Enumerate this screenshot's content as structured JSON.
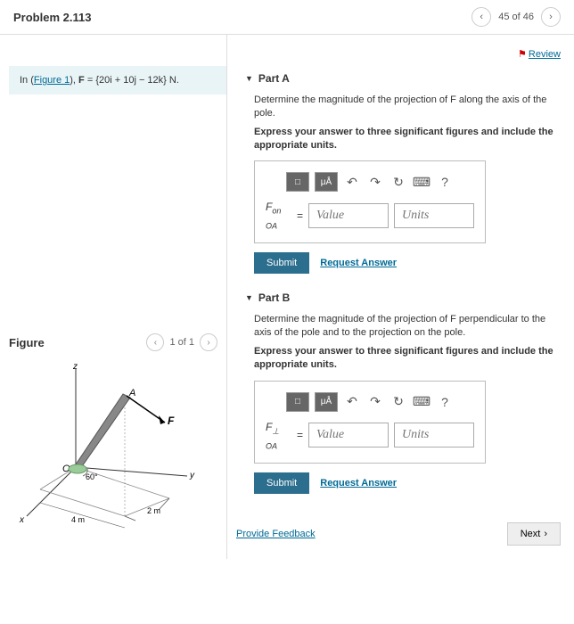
{
  "header": {
    "title": "Problem 2.113",
    "position": "45 of 46"
  },
  "review_label": "Review",
  "intro": {
    "prefix": "In (",
    "figure_link": "Figure 1",
    "suffix": "), ",
    "equation_lhs": "F",
    "equation_eq": " = ",
    "equation_rhs": "{20i + 10j − 12k}",
    "equation_unit": " N."
  },
  "partA": {
    "title": "Part A",
    "description": "Determine the magnitude of the projection of F along the axis of the pole.",
    "instruction": "Express your answer to three significant figures and include the appropriate units.",
    "label_html": "F",
    "label_sub": "on OA",
    "eq": "=",
    "value_ph": "Value",
    "units_ph": "Units",
    "submit": "Submit",
    "request": "Request Answer",
    "toolbar": {
      "t1": "□",
      "t2": "μÅ",
      "help": "?"
    }
  },
  "partB": {
    "title": "Part B",
    "description": "Determine the magnitude of the projection of F perpendicular to the axis of the pole and to the projection on the pole.",
    "instruction": "Express your answer to three significant figures and include the appropriate units.",
    "label_html": "F",
    "label_sub": "⊥ OA",
    "eq": "=",
    "value_ph": "Value",
    "units_ph": "Units",
    "submit": "Submit",
    "request": "Request Answer",
    "toolbar": {
      "t1": "□",
      "t2": "μÅ",
      "help": "?"
    }
  },
  "figure": {
    "title": "Figure",
    "position": "1 of 1",
    "labels": {
      "z": "z",
      "x": "x",
      "y": "y",
      "A": "A",
      "O": "O",
      "F": "F",
      "angle": "60°",
      "dim1": "2 m",
      "dim2": "4 m"
    }
  },
  "feedback": "Provide Feedback",
  "next": "Next"
}
